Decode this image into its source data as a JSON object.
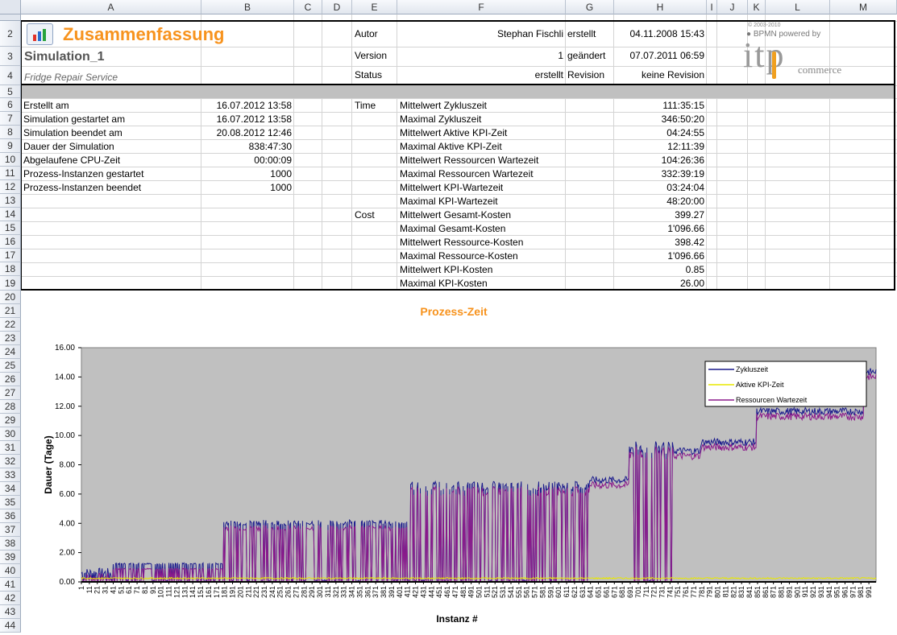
{
  "columns": [
    "A",
    "B",
    "C",
    "D",
    "E",
    "F",
    "G",
    "H",
    "I",
    "J",
    "K",
    "L",
    "M"
  ],
  "rows": [
    "2",
    "3",
    "4",
    "5",
    "6",
    "7",
    "8",
    "9",
    "10",
    "11",
    "12",
    "13",
    "14",
    "15",
    "16",
    "17",
    "18",
    "19",
    "20",
    "21",
    "22",
    "23",
    "24",
    "25",
    "26",
    "27",
    "28",
    "29",
    "30",
    "31",
    "32",
    "33",
    "34",
    "35",
    "36",
    "37",
    "38",
    "39",
    "40",
    "41",
    "42",
    "43",
    "44"
  ],
  "header": {
    "title": "Zusammenfassung",
    "simulation": "Simulation_1",
    "process": "Fridge Repair Service",
    "author_label": "Autor",
    "author": "Stephan Fischli",
    "created_label": "erstellt",
    "created": "04.11.2008 15:43",
    "version_label": "Version",
    "version": "1",
    "changed_label": "geändert",
    "changed": "07.07.2011 06:59",
    "status_label": "Status",
    "status": "erstellt",
    "revision_label": "Revision",
    "revision": "keine Revision",
    "logo_copyright": "© 2003-2010",
    "logo_bpmn": "● BPMN powered by",
    "logo_itp": "itp",
    "logo_commerce": "commerce"
  },
  "summary": [
    {
      "label": "Erstellt am",
      "value": "16.07.2012 13:58"
    },
    {
      "label": "Simulation gestartet am",
      "value": "16.07.2012 13:58"
    },
    {
      "label": "Simulation beendet am",
      "value": "20.08.2012 12:46"
    },
    {
      "label": "Dauer der Simulation",
      "value": "838:47:30"
    },
    {
      "label": "Abgelaufene CPU-Zeit",
      "value": "00:00:09"
    },
    {
      "label": "Prozess-Instanzen gestartet",
      "value": "1000"
    },
    {
      "label": "Prozess-Instanzen beendet",
      "value": "1000"
    }
  ],
  "metrics": [
    {
      "group": "Time",
      "label": "Mittelwert Zykluszeit",
      "value": "111:35:15"
    },
    {
      "group": "",
      "label": "Maximal Zykluszeit",
      "value": "346:50:20"
    },
    {
      "group": "",
      "label": "Mittelwert Aktive KPI-Zeit",
      "value": "04:24:55"
    },
    {
      "group": "",
      "label": "Maximal Aktive KPI-Zeit",
      "value": "12:11:39"
    },
    {
      "group": "",
      "label": "Mittelwert Ressourcen Wartezeit",
      "value": "104:26:36"
    },
    {
      "group": "",
      "label": "Maximal Ressourcen Wartezeit",
      "value": "332:39:19"
    },
    {
      "group": "",
      "label": "Mittelwert KPI-Wartezeit",
      "value": "03:24:04"
    },
    {
      "group": "",
      "label": "Maximal KPI-Wartezeit",
      "value": "48:20:00"
    },
    {
      "group": "Cost",
      "label": "Mittelwert Gesamt-Kosten",
      "value": "399.27"
    },
    {
      "group": "",
      "label": "Maximal Gesamt-Kosten",
      "value": "1'096.66"
    },
    {
      "group": "",
      "label": "Mittelwert Ressource-Kosten",
      "value": "398.42"
    },
    {
      "group": "",
      "label": "Maximal Ressource-Kosten",
      "value": "1'096.66"
    },
    {
      "group": "",
      "label": "Mittelwert KPI-Kosten",
      "value": "0.85"
    },
    {
      "group": "",
      "label": "Maximal KPI-Kosten",
      "value": "26.00"
    }
  ],
  "colors": {
    "title": "#f7931e",
    "zyklus": "#1a1a8c",
    "aktiv": "#e8e800",
    "ressourcen": "#8b1a8b",
    "plot_bg": "#c0c0c0"
  },
  "chart_data": {
    "type": "line",
    "title": "Prozess-Zeit",
    "xlabel": "Instanz #",
    "ylabel": "Dauer (Tage)",
    "ylim": [
      0,
      16
    ],
    "yticks": [
      "0.00",
      "2.00",
      "4.00",
      "6.00",
      "8.00",
      "10.00",
      "12.00",
      "14.00",
      "16.00"
    ],
    "xticks": [
      1,
      11,
      21,
      31,
      41,
      51,
      61,
      71,
      81,
      91,
      101,
      111,
      121,
      131,
      141,
      151,
      161,
      171,
      181,
      191,
      201,
      211,
      221,
      231,
      241,
      251,
      261,
      271,
      281,
      291,
      301,
      311,
      321,
      331,
      341,
      351,
      361,
      371,
      381,
      391,
      401,
      411,
      421,
      431,
      441,
      451,
      461,
      471,
      481,
      491,
      501,
      511,
      521,
      531,
      541,
      551,
      561,
      571,
      581,
      591,
      601,
      611,
      621,
      631,
      641,
      651,
      661,
      671,
      681,
      691,
      701,
      711,
      721,
      731,
      741,
      751,
      761,
      771,
      781,
      791,
      801,
      811,
      821,
      831,
      841,
      851,
      861,
      871,
      881,
      891,
      901,
      911,
      921,
      931,
      941,
      951,
      961,
      971,
      981,
      991
    ],
    "x_range": [
      1,
      1000
    ],
    "legend": "top-right",
    "segments": [
      {
        "x": [
          1,
          40
        ],
        "level": 0.5,
        "mode": "spiky"
      },
      {
        "x": [
          40,
          180
        ],
        "level": 1.0,
        "mode": "dense"
      },
      {
        "x": [
          180,
          415
        ],
        "level": 3.8,
        "mode": "dense"
      },
      {
        "x": [
          415,
          640
        ],
        "level": 6.3,
        "mode": "dense"
      },
      {
        "x": [
          640,
          690
        ],
        "level": 6.7,
        "mode": "solid"
      },
      {
        "x": [
          690,
          745
        ],
        "level": 8.9,
        "mode": "dense"
      },
      {
        "x": [
          745,
          780
        ],
        "level": 8.7,
        "mode": "solid"
      },
      {
        "x": [
          780,
          850
        ],
        "level": 9.3,
        "mode": "solid"
      },
      {
        "x": [
          850,
          985
        ],
        "level": 11.4,
        "mode": "solid"
      },
      {
        "x": [
          985,
          1000
        ],
        "level": 14.1,
        "mode": "solid"
      }
    ],
    "series": [
      {
        "name": "Zykluszeit",
        "offset": 0.25
      },
      {
        "name": "Aktive KPI-Zeit",
        "level": 0.2
      },
      {
        "name": "Ressourcen Wartezeit",
        "offset": 0
      }
    ]
  }
}
